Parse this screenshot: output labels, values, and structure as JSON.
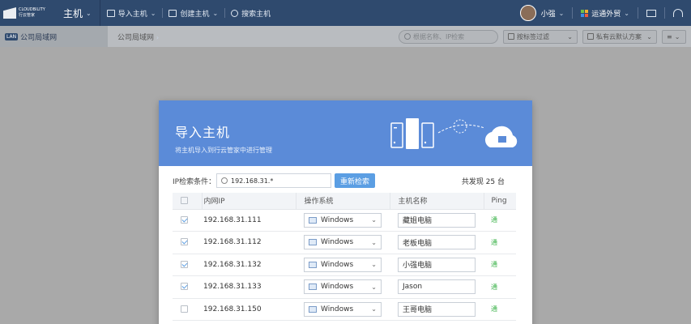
{
  "topbar": {
    "logo_line1": "CLOUDBILITY",
    "logo_line2": "行云管家",
    "section": "主机",
    "nav": [
      {
        "label": "导入主机",
        "icon": "import-icon"
      },
      {
        "label": "创建主机",
        "icon": "create-icon"
      },
      {
        "label": "搜索主机",
        "icon": "search-icon"
      }
    ],
    "user": "小强",
    "brand": "运通外贸"
  },
  "subbar": {
    "lan_badge": "LAN",
    "lan_label": "公司局域网",
    "breadcrumb": "公司局域网",
    "search_placeholder": "根据名称、IP检索",
    "filter1": "按标签过滤",
    "filter2": "私有云默认方案"
  },
  "modal": {
    "title": "导入主机",
    "subtitle": "将主机导入到行云管家中进行管理",
    "search_label": "IP检索条件：",
    "ip_value": "192.168.31.*",
    "research_button": "重新检索",
    "total": "共发现 25 台",
    "columns": [
      "内网IP",
      "操作系统",
      "主机名称",
      "Ping"
    ],
    "rows": [
      {
        "checked": true,
        "ip": "192.168.31.111",
        "os": "Windows",
        "name": "藏姐电脑",
        "ping": "通"
      },
      {
        "checked": true,
        "ip": "192.168.31.112",
        "os": "Windows",
        "name": "老板电脑",
        "ping": "通"
      },
      {
        "checked": true,
        "ip": "192.168.31.132",
        "os": "Windows",
        "name": "小强电脑",
        "ping": "通"
      },
      {
        "checked": true,
        "ip": "192.168.31.133",
        "os": "Windows",
        "name": "Jason",
        "ping": "通"
      },
      {
        "checked": false,
        "ip": "192.168.31.150",
        "os": "Windows",
        "name": "王哥电脑",
        "ping": "通"
      }
    ]
  },
  "colors": {
    "topbar": "#2f4a6e",
    "modal_header": "#5b8bd8",
    "button": "#5b9ee3",
    "ping_ok": "#3cb34a"
  }
}
